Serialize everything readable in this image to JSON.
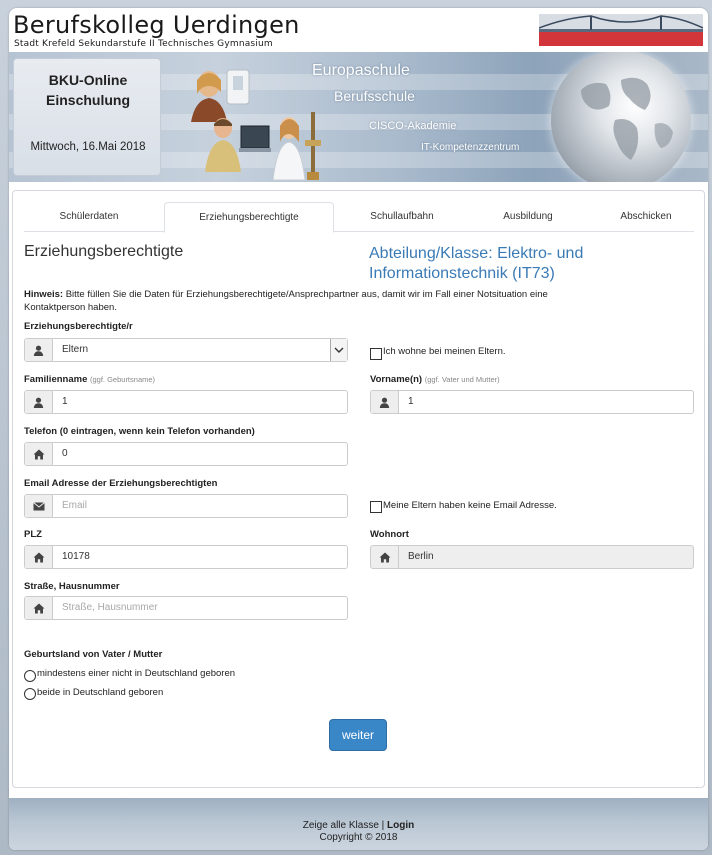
{
  "header": {
    "school_name": "Berufskolleg Uerdingen",
    "school_subtitle": "Stadt Krefeld  Sekundarstufe II  Technisches Gymnasium"
  },
  "banner": {
    "app_title": "BKU-Online Einschulung",
    "date": "Mittwoch, 16.Mai 2018",
    "slogans": [
      "Europaschule",
      "Berufsschule",
      "CISCO-Akademie",
      "IT-Kompetenzzentrum"
    ]
  },
  "tabs": [
    {
      "label": "Schülerdaten",
      "active": false
    },
    {
      "label": "Erziehungsberechtigte",
      "active": true
    },
    {
      "label": "Schullaufbahn",
      "active": false
    },
    {
      "label": "Ausbildung",
      "active": false
    },
    {
      "label": "Abschicken",
      "active": false
    }
  ],
  "form": {
    "section_title": "Erziehungsberechtigte",
    "class_title": "Abteilung/Klasse: Elektro- und Informationstechnik (IT73)",
    "hint_label": "Hinweis:",
    "hint_text": " Bitte füllen Sie die Daten für Erziehungsberechtigete/Ansprechpartner aus, damit wir im Fall einer Notsituation eine Kontaktperson haben.",
    "guardian": {
      "label": "Erziehungsberechtigte/r",
      "value": "Eltern"
    },
    "live_with_parents": {
      "label": "Ich wohne bei meinen Eltern.",
      "checked": false
    },
    "lastname": {
      "label": "Familienname",
      "hint": "(ggf. Geburtsname)",
      "value": "1"
    },
    "firstname": {
      "label": "Vorname(n)",
      "hint": "(ggf. Vater und Mutter)",
      "value": "1"
    },
    "phone": {
      "label": "Telefon (0 eintragen, wenn kein Telefon vorhanden)",
      "value": "0"
    },
    "email": {
      "label": "Email Adresse der Erziehungsberechtigten",
      "value": "",
      "placeholder": "Email"
    },
    "no_email": {
      "label": "Meine Eltern haben keine Email Adresse.",
      "checked": false
    },
    "zip": {
      "label": "PLZ",
      "value": "10178"
    },
    "city": {
      "label": "Wohnort",
      "value": "Berlin"
    },
    "street": {
      "label": "Straße, Hausnummer",
      "value": "",
      "placeholder": "Straße, Hausnummer"
    },
    "birth_country": {
      "label": "Geburtsland von Vater / Mutter",
      "options": [
        "mindestens einer nicht in Deutschland geboren",
        "beide in Deutschland geboren"
      ],
      "selected": null
    },
    "next_button": "weiter"
  },
  "footer": {
    "show_all": "Zeige alle Klasse",
    "separator": " | ",
    "login": "Login",
    "copyright": "Copyright © 2018"
  },
  "colors": {
    "accent": "#3a87c8",
    "class_title": "#3a7ab5"
  }
}
